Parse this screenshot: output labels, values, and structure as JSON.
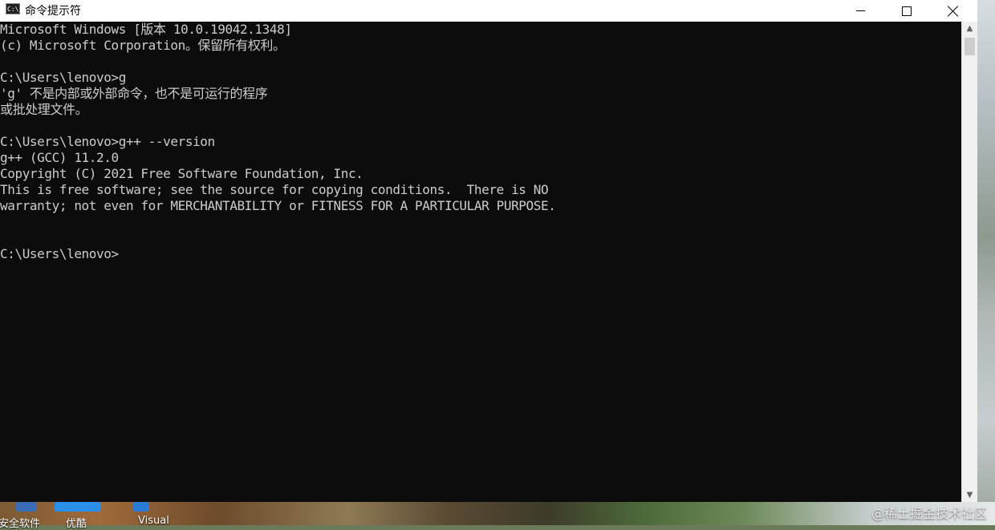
{
  "window": {
    "title": "命令提示符",
    "icon_label": "C:\\",
    "buttons": {
      "minimize": "minimize-icon",
      "maximize": "maximize-icon",
      "close": "close-icon"
    }
  },
  "console": {
    "lines": [
      "Microsoft Windows [版本 10.0.19042.1348]",
      "(c) Microsoft Corporation。保留所有权利。",
      "",
      "C:\\Users\\lenovo>g",
      "'g' 不是内部或外部命令，也不是可运行的程序",
      "或批处理文件。",
      "",
      "C:\\Users\\lenovo>g++ --version",
      "g++ (GCC) 11.2.0",
      "Copyright (C) 2021 Free Software Foundation, Inc.",
      "This is free software; see the source for copying conditions.  There is NO",
      "warranty; not even for MERCHANTABILITY or FITNESS FOR A PARTICULAR PURPOSE.",
      "",
      "",
      "C:\\Users\\lenovo>"
    ]
  },
  "scrollbar": {
    "up": "▲",
    "down": "▼"
  },
  "desktop": {
    "icons": [
      {
        "label": "安全软件",
        "icon": "shield-app-icon"
      },
      {
        "label": "优酷",
        "icon": "youku-app-icon"
      },
      {
        "label": "Visual",
        "icon": "visual-studio-icon"
      }
    ],
    "watermark": "@稀土掘金技术社区"
  },
  "colors": {
    "console_bg": "#0c0c0c",
    "console_fg": "#cccccc",
    "titlebar_bg": "#ffffff"
  }
}
